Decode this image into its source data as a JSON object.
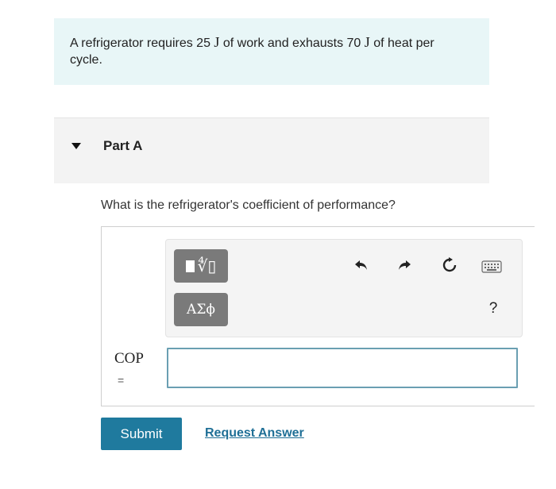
{
  "problem": {
    "text_before_work": "A refrigerator requires 25 ",
    "work_unit": "J",
    "text_middle": " of work and exhausts 70 ",
    "heat_unit": "J",
    "text_after": " of heat per cycle."
  },
  "part": {
    "title": "Part A",
    "question": "What is the refrigerator's coefficient of performance?"
  },
  "toolbar": {
    "symbols_label": "ΑΣϕ",
    "help_label": "?"
  },
  "answer": {
    "label": "COP",
    "equals": "=",
    "value": ""
  },
  "actions": {
    "submit_label": "Submit",
    "request_label": "Request Answer"
  },
  "colors": {
    "problem_bg": "#e8f6f7",
    "submit_bg": "#1f7a9e",
    "link": "#1f6f96",
    "input_border": "#6a9fb2"
  }
}
